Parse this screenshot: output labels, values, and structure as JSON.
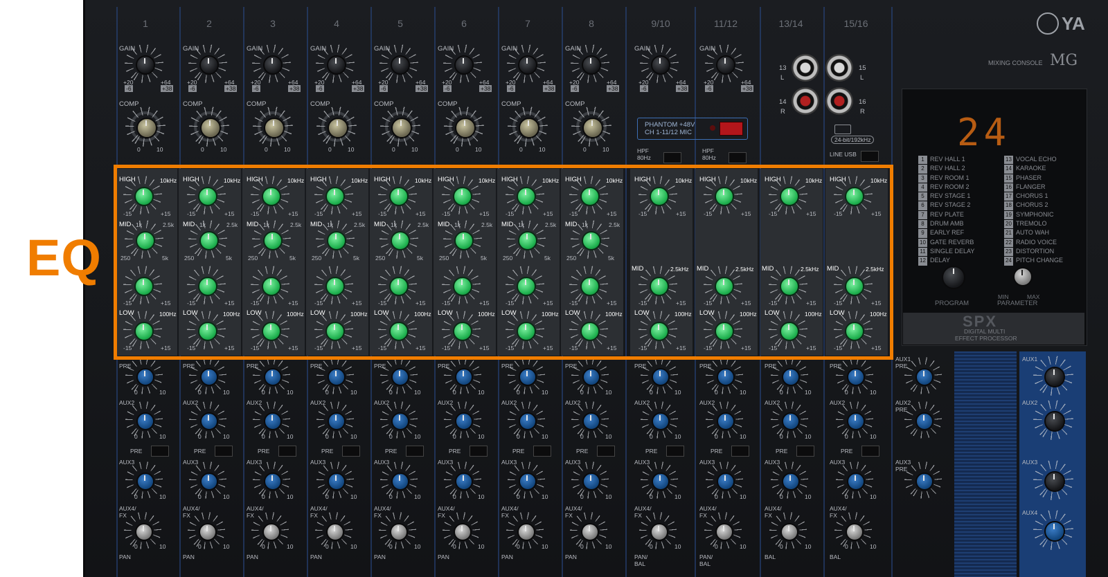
{
  "annotation": {
    "label": "EQ",
    "highlight_color": "#f07d00"
  },
  "brand": {
    "logo_text": "YA",
    "model_label": "MIXING CONSOLE",
    "model_prefix": "MG"
  },
  "channels": [
    "1",
    "2",
    "3",
    "4",
    "5",
    "6",
    "7",
    "8",
    "9/10",
    "11/12",
    "13/14",
    "15/16"
  ],
  "top_labels": {
    "gain": "GAIN",
    "comp": "COMP",
    "gain_min": "+20",
    "gain_min_sub": "-6",
    "gain_max": "+64",
    "gain_max_sub": "+38",
    "comp_min": "0",
    "comp_max": "10"
  },
  "eq_labels": {
    "high": "HIGH",
    "high_freq": "10kHz",
    "minus": "-15",
    "plus": "+15",
    "mid": "MID",
    "mid_low": "1k",
    "mid_high": "2.5k",
    "mid_min": "250",
    "mid_max": "5k",
    "stereo_mid_freq": "2.5kHz",
    "low": "LOW",
    "low_freq": "100Hz"
  },
  "aux_labels": {
    "aux1": "AUX1",
    "aux2": "AUX2",
    "aux3": "AUX3",
    "aux4fx": "AUX4/ FX",
    "pre": "PRE",
    "pan": "PAN",
    "pan_stereo": "PAN/ BAL",
    "bal": "BAL",
    "min": "0",
    "max": "10"
  },
  "phantom": {
    "line1": "PHANTOM +48V",
    "line2": "CH 1-11/12 MIC",
    "hpf": "HPF 80Hz"
  },
  "stereo_inputs": {
    "j13": "13",
    "j15": "15",
    "j14": "14",
    "j16": "16",
    "l": "L",
    "r": "R",
    "usb_badge": "24-bit/192kHz",
    "line_usb": "LINE USB"
  },
  "spx": {
    "display": "24",
    "programs_left": [
      {
        "n": "1",
        "name": "REV HALL 1"
      },
      {
        "n": "2",
        "name": "REV HALL 2"
      },
      {
        "n": "3",
        "name": "REV ROOM 1"
      },
      {
        "n": "4",
        "name": "REV ROOM 2"
      },
      {
        "n": "5",
        "name": "REV STAGE 1"
      },
      {
        "n": "6",
        "name": "REV STAGE 2"
      },
      {
        "n": "7",
        "name": "REV PLATE"
      },
      {
        "n": "8",
        "name": "DRUM AMB"
      },
      {
        "n": "9",
        "name": "EARLY REF"
      },
      {
        "n": "10",
        "name": "GATE REVERB"
      },
      {
        "n": "11",
        "name": "SINGLE DELAY"
      },
      {
        "n": "12",
        "name": "DELAY"
      }
    ],
    "programs_right": [
      {
        "n": "13",
        "name": "VOCAL ECHO"
      },
      {
        "n": "14",
        "name": "KARAOKE"
      },
      {
        "n": "15",
        "name": "PHASER"
      },
      {
        "n": "16",
        "name": "FLANGER"
      },
      {
        "n": "17",
        "name": "CHORUS 1"
      },
      {
        "n": "18",
        "name": "CHORUS 2"
      },
      {
        "n": "19",
        "name": "SYMPHONIC"
      },
      {
        "n": "20",
        "name": "TREMOLO"
      },
      {
        "n": "21",
        "name": "AUTO WAH"
      },
      {
        "n": "22",
        "name": "RADIO VOICE"
      },
      {
        "n": "23",
        "name": "DISTORTION"
      },
      {
        "n": "24",
        "name": "PITCH CHANGE"
      }
    ],
    "program_label": "PROGRAM",
    "parameter_label": "PARAMETER",
    "param_min": "MIN",
    "param_max": "MAX",
    "logo": "SPX",
    "subtitle1": "DIGITAL MULTI",
    "subtitle2": "EFFECT PROCESSOR"
  },
  "master": {
    "aux1": "AUX1",
    "aux2": "AUX2",
    "aux3": "AUX3",
    "aux4": "AUX4",
    "pre": "PRE",
    "aux2_pre": "AUX2 PRE",
    "aux3_pre": "AUX3 PRE"
  },
  "colors": {
    "eq_knob": "#2ecc5a",
    "aux_knob": "#12467e",
    "comp_knob": "#c9c4a0",
    "strip_line": "#2a4a8a"
  }
}
